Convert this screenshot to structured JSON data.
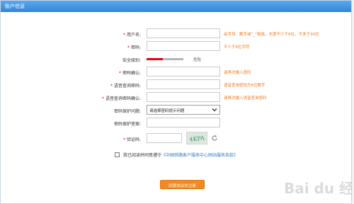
{
  "title": "账户信息",
  "form": {
    "rows": [
      {
        "label": "用户名:",
        "required": true,
        "hint": "由字母、数字或“_”组成，长度不少于6位，不多于30位"
      },
      {
        "label": "密码:",
        "required": true,
        "hint": "不少于6位字符"
      },
      {
        "label": "安全级别:",
        "required": false,
        "strength_label": "危险",
        "strength_level": 0.45
      },
      {
        "label": "密码确认:",
        "required": true,
        "hint": "请再次输入密码"
      },
      {
        "label": "语音查询密码:",
        "required": true,
        "hint": "语音查询密码为6位数字"
      },
      {
        "label": "语音查询密码确认:",
        "required": true,
        "hint": "请再次输入语音查询密码"
      },
      {
        "label": "密码保护问题:",
        "required": false,
        "select_value": "请选择密码提示问题"
      },
      {
        "label": "密码保护答案:",
        "required": false
      },
      {
        "label": "验证码:",
        "required": true,
        "captcha_text": "4KPA"
      }
    ],
    "agree_text": "我已阅读并同意遵守",
    "agree_link": "《中国铁路客户服务中心网站服务条款》",
    "submit_label": "同意协议并注册"
  },
  "watermark": "Bai du 经验",
  "colors": {
    "accent": "#2f86d8",
    "hint": "#f07a1a",
    "required": "#e60000",
    "submit": "#f08a24",
    "strength": "#e60012"
  }
}
